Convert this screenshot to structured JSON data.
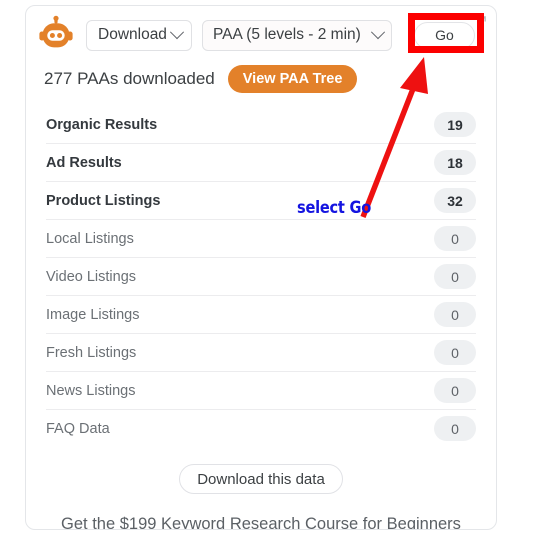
{
  "app": {
    "logo_icon": "robot-icon"
  },
  "toolbar": {
    "download_label": "Download",
    "download_caret_icon": "chevron-down-icon",
    "paa_select_value": "PAA (5 levels - 2 min)",
    "paa_select_caret_icon": "chevron-down-icon",
    "go_label": "Go",
    "popout_icon": "external-link-icon"
  },
  "summary": {
    "text": "277 PAAs downloaded",
    "view_tree_label": "View PAA Tree"
  },
  "results": {
    "rows": [
      {
        "label": "Organic Results",
        "count": "19",
        "emphasis": true
      },
      {
        "label": "Ad Results",
        "count": "18",
        "emphasis": true
      },
      {
        "label": "Product Listings",
        "count": "32",
        "emphasis": true
      },
      {
        "label": "Local Listings",
        "count": "0",
        "emphasis": false
      },
      {
        "label": "Video Listings",
        "count": "0",
        "emphasis": false
      },
      {
        "label": "Image Listings",
        "count": "0",
        "emphasis": false
      },
      {
        "label": "Fresh Listings",
        "count": "0",
        "emphasis": false
      },
      {
        "label": "News Listings",
        "count": "0",
        "emphasis": false
      },
      {
        "label": "FAQ Data",
        "count": "0",
        "emphasis": false
      }
    ]
  },
  "footer": {
    "download_data_label": "Download this data",
    "course_text": "Get the $199 Keyword Research Course for Beginners"
  },
  "annotations": {
    "callout_text": "select  Go",
    "highlight_color": "#fc0000",
    "arrow_color": "#ee1111",
    "callout_color": "#1414e0"
  },
  "colors": {
    "brand_orange": "#e3812a",
    "badge_bg": "#eef0f2",
    "card_border": "#e4e6e9"
  }
}
